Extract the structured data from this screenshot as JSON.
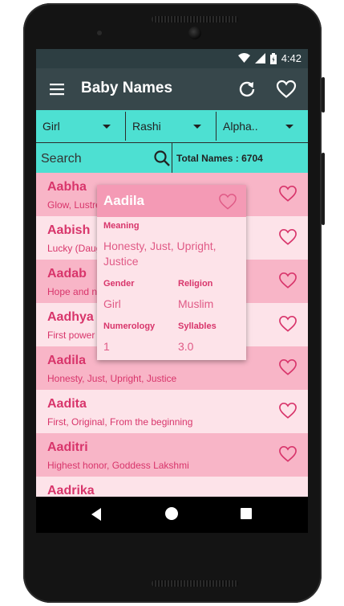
{
  "status": {
    "time": "4:42"
  },
  "appbar": {
    "title": "Baby Names"
  },
  "filters": {
    "gender": "Girl",
    "rashi": "Rashi",
    "alpha": "Alpha.."
  },
  "search": {
    "placeholder": "Search",
    "total_label": "Total Names : 6704"
  },
  "names": [
    {
      "name": "Aabha",
      "meaning": "Glow, Lustre"
    },
    {
      "name": "Aabish",
      "meaning": "Lucky (Daughter)"
    },
    {
      "name": "Aadab",
      "meaning": "Hope and need"
    },
    {
      "name": "Aadhya",
      "meaning": "First power"
    },
    {
      "name": "Aadila",
      "meaning": "Honesty, Just, Upright, Justice"
    },
    {
      "name": "Aadita",
      "meaning": "First, Original, From the beginning"
    },
    {
      "name": "Aaditri",
      "meaning": "Highest honor, Goddess Lakshmi"
    },
    {
      "name": "Aadrika",
      "meaning": ""
    }
  ],
  "detail": {
    "name": "Aadila",
    "meaning_label": "Meaning",
    "meaning_value": "Honesty, Just, Upright, Justice",
    "gender_label": "Gender",
    "gender_value": "Girl",
    "religion_label": "Religion",
    "religion_value": "Muslim",
    "numerology_label": "Numerology",
    "numerology_value": "1",
    "syllables_label": "Syllables",
    "syllables_value": "3.0"
  },
  "colors": {
    "accent": "#d8356b",
    "teal": "#4de0d2",
    "appbar": "#37474b",
    "row_dark": "#f8b5c7",
    "row_light": "#fde3e9"
  },
  "icons": [
    "menu-icon",
    "refresh-icon",
    "heart-icon",
    "search-icon",
    "wifi-icon",
    "signal-icon",
    "battery-icon",
    "back-icon",
    "home-icon",
    "recents-icon"
  ]
}
